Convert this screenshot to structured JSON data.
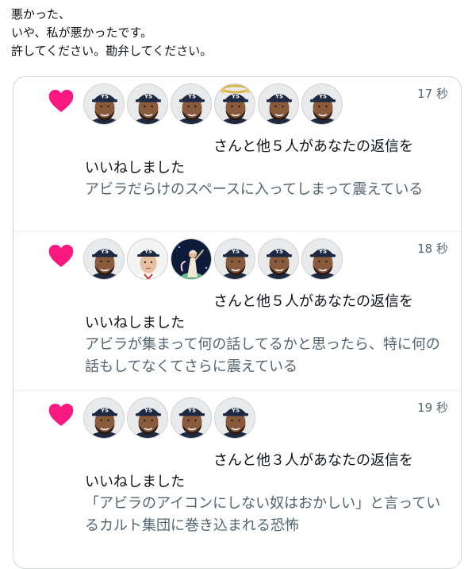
{
  "tweet": {
    "lines": [
      "悪かった、",
      "いや、私が悪かったです。",
      "許してください。勘弁してください。"
    ]
  },
  "colors": {
    "heart": "#f91880",
    "muted_text": "#536471",
    "border": "#cfd9de",
    "cap_navy": "#1e2a44"
  },
  "notifications": [
    {
      "time": "17 秒",
      "icon": "heart-icon",
      "summary": "さんと他５人があなたの返信を",
      "action": "いいねしました",
      "quote": "アビラだらけのスペースに入ってしまって震えている",
      "avatars": [
        "avila-avatar",
        "avila-avatar",
        "avila-avatar",
        "avila-gold-halo-avatar",
        "avila-avatar",
        "avila-avatar"
      ]
    },
    {
      "time": "18 秒",
      "icon": "heart-icon",
      "summary": "さんと他５人があなたの返信を",
      "action": "いいねしました",
      "quote": "アビラが集まって何の話してるかと思ったら、特に何の話もしてなくてさらに震えている",
      "avatars": [
        "avila-avatar",
        "young-player-avatar",
        "stage-performer-avatar",
        "avila-avatar",
        "avila-avatar",
        "avila-avatar"
      ]
    },
    {
      "time": "19 秒",
      "icon": "heart-icon",
      "summary": "さんと他３人があなたの返信を",
      "action": "いいねしました",
      "quote": "「アビラのアイコンにしない奴はおかしい」と言っているカルト集団に巻き込まれる恐怖",
      "avatars": [
        "avila-avatar",
        "avila-avatar",
        "avila-avatar",
        "avila-avatar"
      ]
    }
  ]
}
